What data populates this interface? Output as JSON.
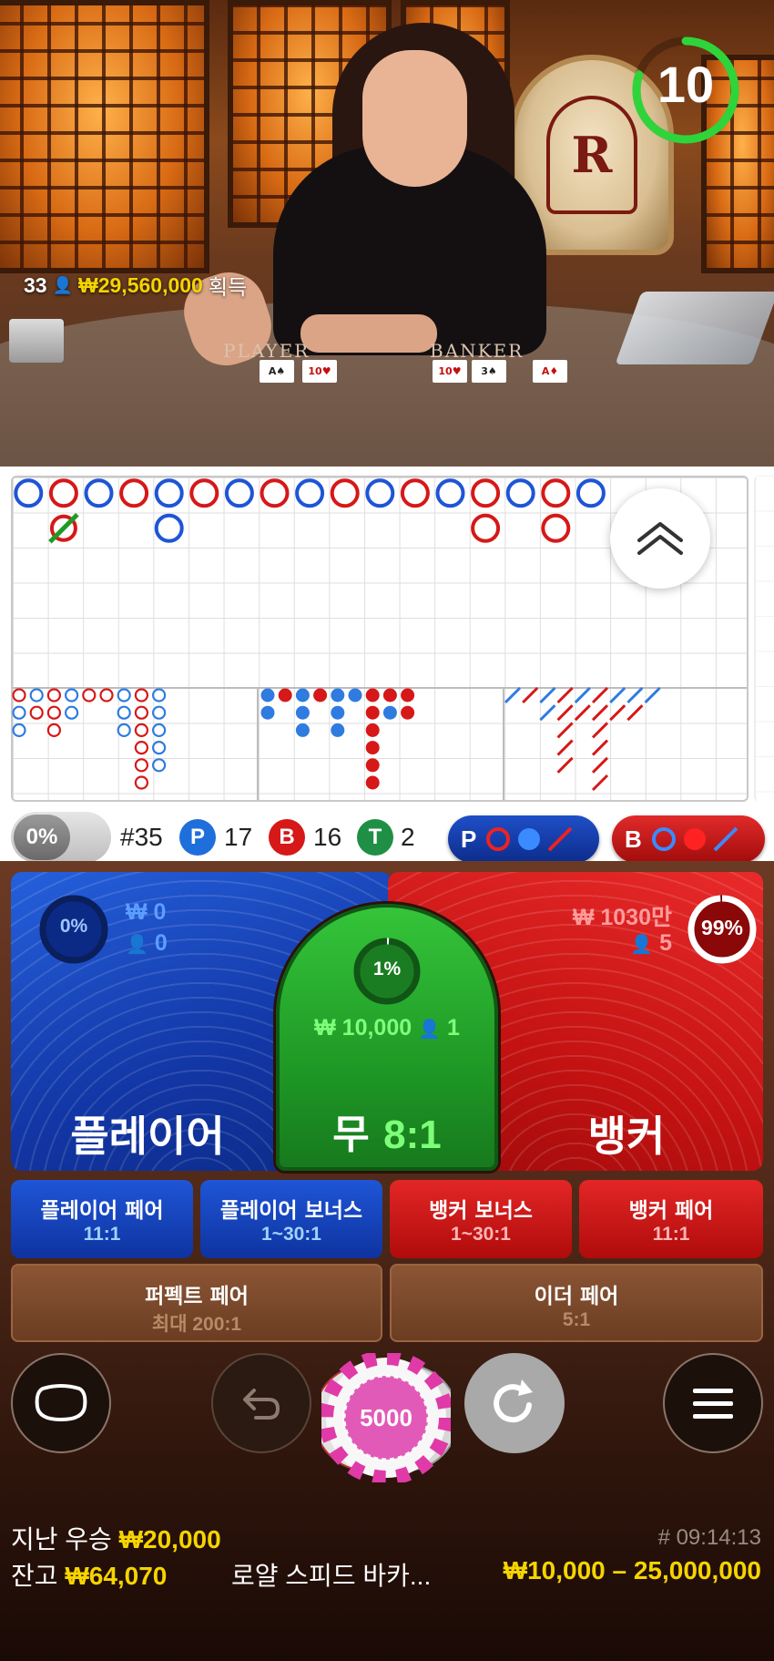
{
  "timer": {
    "seconds": "10",
    "progress": 0.8
  },
  "video": {
    "winners_count": "33",
    "winners_amount": "₩29,560,000",
    "winners_suffix": "획득",
    "felt_player": "PLAYER",
    "felt_banker": "BANKER",
    "player_cards": [
      "A♠",
      "10♥"
    ],
    "banker_cards": [
      "10♥",
      "3♠",
      "A♦"
    ]
  },
  "roadmap": {
    "shoe_number": "#35",
    "player_badge": "P",
    "player_count": "17",
    "banker_badge": "B",
    "banker_count": "16",
    "tie_badge": "T",
    "tie_count": "2",
    "percent_toggle": "0%",
    "predict_player_label": "P",
    "predict_banker_label": "B",
    "big_road": [
      {
        "col": 0,
        "row": 0,
        "r": "P"
      },
      {
        "col": 1,
        "row": 0,
        "r": "B"
      },
      {
        "col": 1,
        "row": 1,
        "r": "T"
      },
      {
        "col": 2,
        "row": 0,
        "r": "P"
      },
      {
        "col": 3,
        "row": 0,
        "r": "B"
      },
      {
        "col": 4,
        "row": 0,
        "r": "P"
      },
      {
        "col": 4,
        "row": 1,
        "r": "P"
      },
      {
        "col": 5,
        "row": 0,
        "r": "B"
      },
      {
        "col": 6,
        "row": 0,
        "r": "P"
      },
      {
        "col": 7,
        "row": 0,
        "r": "B"
      },
      {
        "col": 8,
        "row": 0,
        "r": "P"
      },
      {
        "col": 9,
        "row": 0,
        "r": "B"
      },
      {
        "col": 10,
        "row": 0,
        "r": "P"
      },
      {
        "col": 11,
        "row": 0,
        "r": "B"
      },
      {
        "col": 12,
        "row": 0,
        "r": "P"
      },
      {
        "col": 13,
        "row": 0,
        "r": "B"
      },
      {
        "col": 13,
        "row": 1,
        "r": "B"
      },
      {
        "col": 14,
        "row": 0,
        "r": "P"
      },
      {
        "col": 15,
        "row": 0,
        "r": "B"
      },
      {
        "col": 15,
        "row": 1,
        "r": "B"
      },
      {
        "col": 16,
        "row": 0,
        "r": "P"
      }
    ]
  },
  "bets": {
    "player": {
      "label": "플레이어",
      "amount": "₩ 0",
      "players": "0",
      "percent": "0%",
      "percent_value": 0
    },
    "tie": {
      "label": "무",
      "odds": "8:1",
      "amount": "₩ 10,000",
      "players": "1",
      "percent": "1%",
      "percent_value": 1
    },
    "banker": {
      "label": "뱅커",
      "amount": "₩ 1030만",
      "players": "5",
      "percent": "99%",
      "percent_value": 99
    },
    "side": [
      {
        "name": "플레이어 페어",
        "odds": "11:1"
      },
      {
        "name": "플레이어 보너스",
        "odds": "1~30:1"
      },
      {
        "name": "뱅커 보너스",
        "odds": "1~30:1"
      },
      {
        "name": "뱅커 페어",
        "odds": "11:1"
      }
    ],
    "pairs": [
      {
        "name": "퍼펙트 페어",
        "odds": "최대 200:1"
      },
      {
        "name": "이더 페어",
        "odds": "5:1"
      }
    ]
  },
  "controls": {
    "chip_value": "5000"
  },
  "footer": {
    "last_win_label": "지난 우승",
    "last_win_value": "₩20,000",
    "balance_label": "잔고",
    "balance_value": "₩64,070",
    "game_name": "로얄 스피드 바카...",
    "limits": "₩10,000 – 25,000,000",
    "round_id": "# 09:14:13"
  },
  "colors": {
    "player": "#1e55d6",
    "banker": "#d61818",
    "tie": "#1f9a26",
    "gold": "#f5d400"
  }
}
